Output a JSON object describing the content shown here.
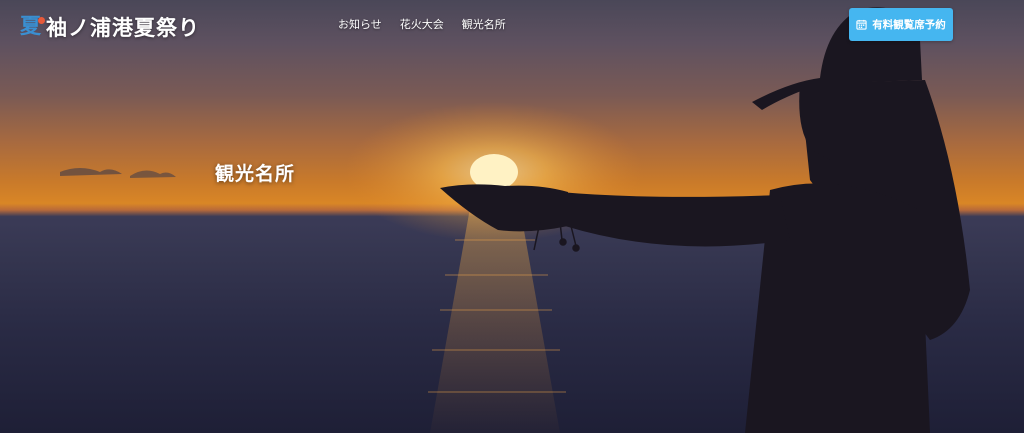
{
  "header": {
    "logo_kanji": "夏",
    "logo_text": "袖ノ浦港夏祭り",
    "nav": [
      {
        "label": "お知らせ"
      },
      {
        "label": "花火大会"
      },
      {
        "label": "観光名所"
      }
    ],
    "cta_label": "有料観覧席予約",
    "cta_icon": "calendar-icon"
  },
  "hero": {
    "title": "観光名所"
  },
  "colors": {
    "cta_background": "#45b6f0",
    "logo_accent": "#3a8fd1",
    "logo_dot": "#e85a3a"
  }
}
